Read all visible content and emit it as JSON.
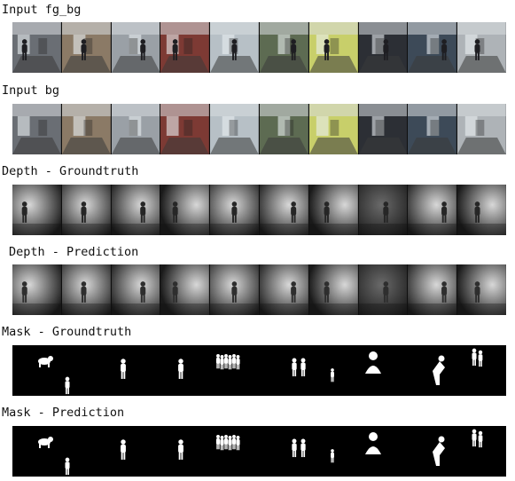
{
  "rows": [
    {
      "label": "Input fg_bg",
      "kind": "rgb"
    },
    {
      "label": "Input bg",
      "kind": "rgb"
    },
    {
      "label": "Depth - Groundtruth",
      "kind": "depth"
    },
    {
      "label": "Depth - Prediction",
      "kind": "depth"
    },
    {
      "label": "Mask - Groundtruth",
      "kind": "mask"
    },
    {
      "label": "Mask - Prediction",
      "kind": "mask"
    }
  ],
  "tile_count": 10,
  "colors": {
    "label_text": "#111111",
    "mask_background": "#000000",
    "mask_foreground": "#ffffff",
    "scene_palette": [
      "#6a6e74",
      "#8b7a66",
      "#9aa0a6",
      "#7d3a34",
      "#b7c0c6",
      "#5d6b52",
      "#c8cf6a",
      "#2c2f35",
      "#3d4a58",
      "#aeb3b7"
    ]
  }
}
